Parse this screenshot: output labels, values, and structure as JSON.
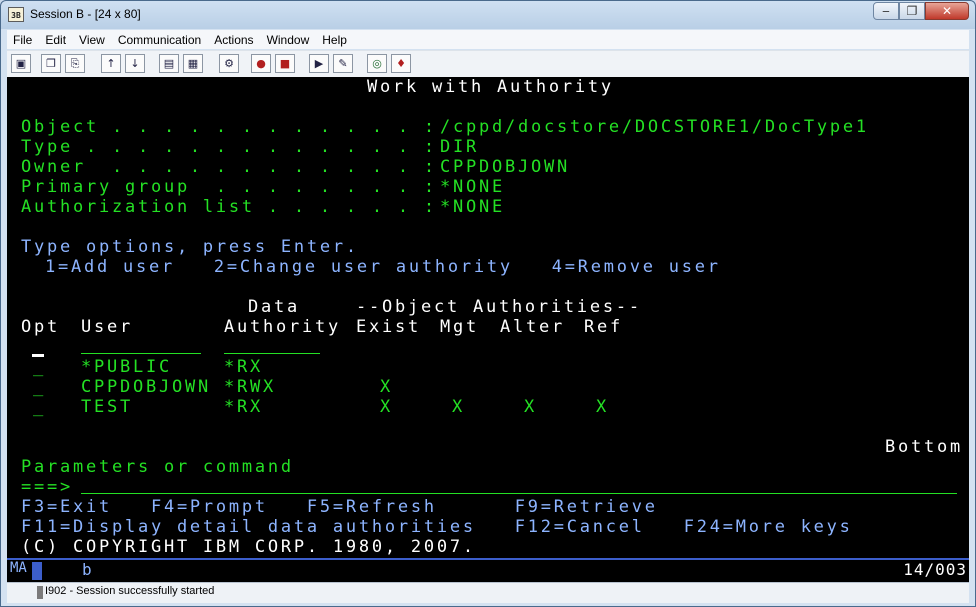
{
  "window": {
    "title": "Session B - [24 x 80]",
    "app_icon_text": "3B"
  },
  "menus": [
    {
      "label": "File"
    },
    {
      "label": "Edit"
    },
    {
      "label": "View"
    },
    {
      "label": "Communication"
    },
    {
      "label": "Actions"
    },
    {
      "label": "Window"
    },
    {
      "label": "Help"
    }
  ],
  "screen": {
    "title": "Work with Authority",
    "fields": [
      {
        "label": "Object . . . . . . . . . . . . :",
        "value": "/cppd/docstore/DOCSTORE1/DocType1"
      },
      {
        "label": "Type . . . . . . . . . . . . . :",
        "value": "DIR"
      },
      {
        "label": "Owner  . . . . . . . . . . . . :",
        "value": "CPPDOBJOWN"
      },
      {
        "label": "Primary group  . . . . . . . . :",
        "value": "*NONE"
      },
      {
        "label": "Authorization list . . . . . . :",
        "value": "*NONE"
      }
    ],
    "instructions": "Type options, press Enter.",
    "options_line": "1=Add user   2=Change user authority   4=Remove user",
    "col_head_data": "Data",
    "col_head_objauth": "--Object Authorities--",
    "col_head_opt": "Opt",
    "col_head_user": "User",
    "col_head_authority": "Authority",
    "col_head_exist": "Exist",
    "col_head_mgt": "Mgt",
    "col_head_alter": "Alter",
    "col_head_ref": "Ref",
    "rows": [
      {
        "opt": "_",
        "user": "*PUBLIC",
        "authority": "*RX",
        "exist": "",
        "mgt": "",
        "alter": "",
        "ref": ""
      },
      {
        "opt": "_",
        "user": "CPPDOBJOWN",
        "authority": "*RWX",
        "exist": "X",
        "mgt": "",
        "alter": "",
        "ref": ""
      },
      {
        "opt": "_",
        "user": "TEST",
        "authority": "*RX",
        "exist": "X",
        "mgt": "X",
        "alter": "X",
        "ref": "X"
      }
    ],
    "bottom_indicator": "Bottom",
    "params_label": "Parameters or command",
    "command_prompt": "===>",
    "fkeys_line1": "F3=Exit   F4=Prompt   F5=Refresh      F9=Retrieve",
    "fkeys_line2": "F11=Display detail data authorities   F12=Cancel   F24=More keys",
    "copyright": "(C) COPYRIGHT IBM CORP. 1980, 2007."
  },
  "oia": {
    "mode": "MA",
    "indicator": "b",
    "cursor_pos": "14/003"
  },
  "status": {
    "message": "I902 - Session successfully started"
  }
}
